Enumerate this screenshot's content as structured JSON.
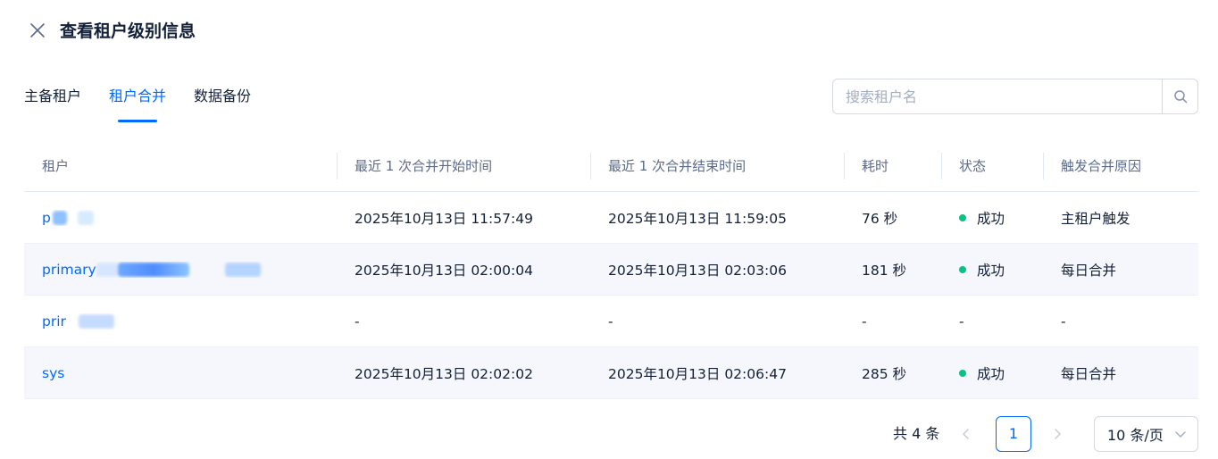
{
  "header": {
    "title": "查看租户级别信息",
    "close_icon": "close-icon"
  },
  "tabs": [
    {
      "label": "主备租户",
      "active": false
    },
    {
      "label": "租户合并",
      "active": true
    },
    {
      "label": "数据备份",
      "active": false
    }
  ],
  "search": {
    "placeholder": "搜索租户名",
    "value": "",
    "icon": "search-icon"
  },
  "table": {
    "columns": [
      "租户",
      "最近 1 次合并开始时间",
      "最近 1 次合并结束时间",
      "耗时",
      "状态",
      "触发合并原因"
    ],
    "rows": [
      {
        "tenant": "p",
        "start": "2025年10月13日 11:57:49",
        "end": "2025年10月13日 11:59:05",
        "duration": "76 秒",
        "status": "成功",
        "reason": "主租户触发"
      },
      {
        "tenant": "primary",
        "start": "2025年10月13日 02:00:04",
        "end": "2025年10月13日 02:03:06",
        "duration": "181 秒",
        "status": "成功",
        "reason": "每日合并"
      },
      {
        "tenant": "prir",
        "start": "-",
        "end": "-",
        "duration": "-",
        "status": "-",
        "reason": "-"
      },
      {
        "tenant": "sys",
        "start": "2025年10月13日 02:02:02",
        "end": "2025年10月13日 02:06:47",
        "duration": "285 秒",
        "status": "成功",
        "reason": "每日合并"
      }
    ]
  },
  "pagination": {
    "total_label": "共 4 条",
    "current_page": "1",
    "page_size": "10 条/页"
  },
  "colors": {
    "accent": "#006aff",
    "success": "#0ac185",
    "text": "#132039",
    "muted": "#5c6b8a",
    "blur_tint": "#a9cdff"
  }
}
